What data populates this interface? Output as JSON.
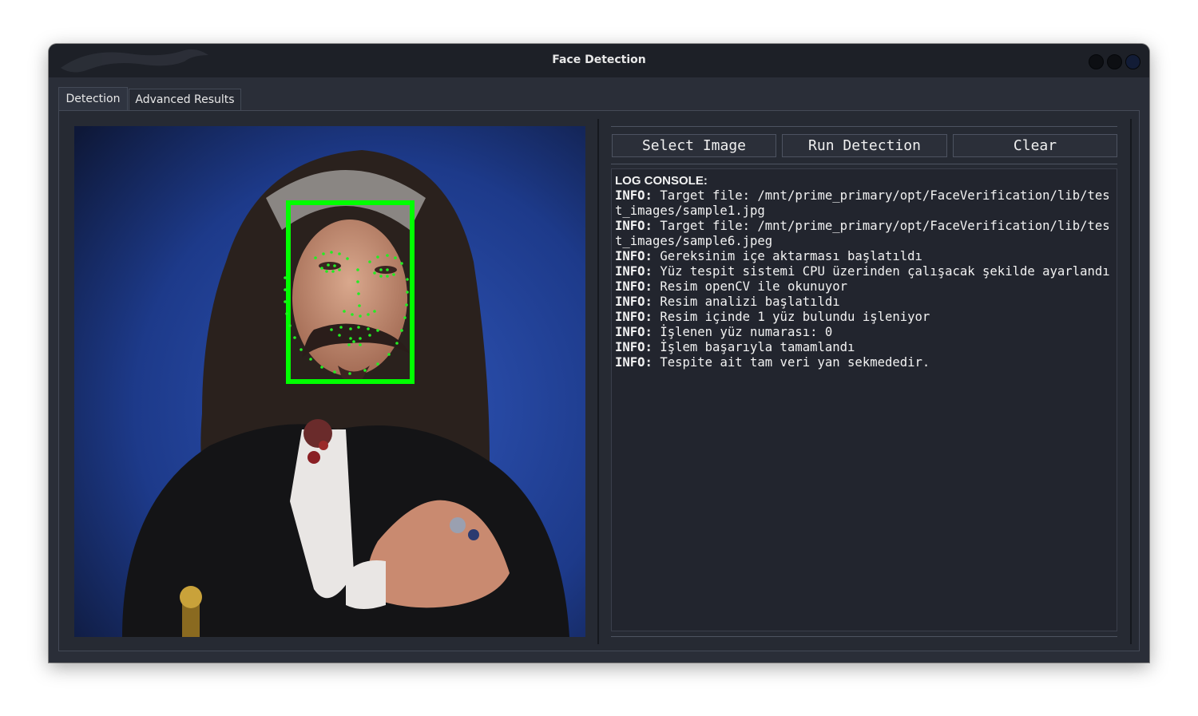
{
  "window": {
    "title": "Face Detection"
  },
  "tabs": [
    {
      "label": "Detection",
      "active": true
    },
    {
      "label": "Advanced Results",
      "active": false
    }
  ],
  "toolbar": {
    "select_label": "Select Image",
    "run_label": "Run Detection",
    "clear_label": "Clear"
  },
  "console": {
    "title": "LOG CONSOLE:",
    "entries": [
      {
        "level": "INFO:",
        "text": " Target file: /mnt/prime_primary/opt/FaceVerification/lib/test_images/sample1.jpg"
      },
      {
        "level": "INFO:",
        "text": " Target file: /mnt/prime_primary/opt/FaceVerification/lib/test_images/sample6.jpeg"
      },
      {
        "level": "INFO:",
        "text": " Gereksinim içe aktarması başlatıldı"
      },
      {
        "level": "INFO:",
        "text": " Yüz tespit sistemi CPU üzerinden çalışacak şekilde ayarlandı"
      },
      {
        "level": "INFO:",
        "text": " Resim openCV ile okunuyor"
      },
      {
        "level": "INFO:",
        "text": " Resim analizi başlatıldı"
      },
      {
        "level": "INFO:",
        "text": " Resim içinde 1 yüz bulundu işleniyor"
      },
      {
        "level": "INFO:",
        "text": " İşlenen yüz numarası: 0"
      },
      {
        "level": "INFO:",
        "text": " İşlem başarıyla tamamlandı"
      },
      {
        "level": "INFO:",
        "text": " Tespite ait tam veri yan sekmededir."
      }
    ]
  },
  "colors": {
    "detection_box": "#00ff00",
    "landmarks": "#22ee22"
  }
}
